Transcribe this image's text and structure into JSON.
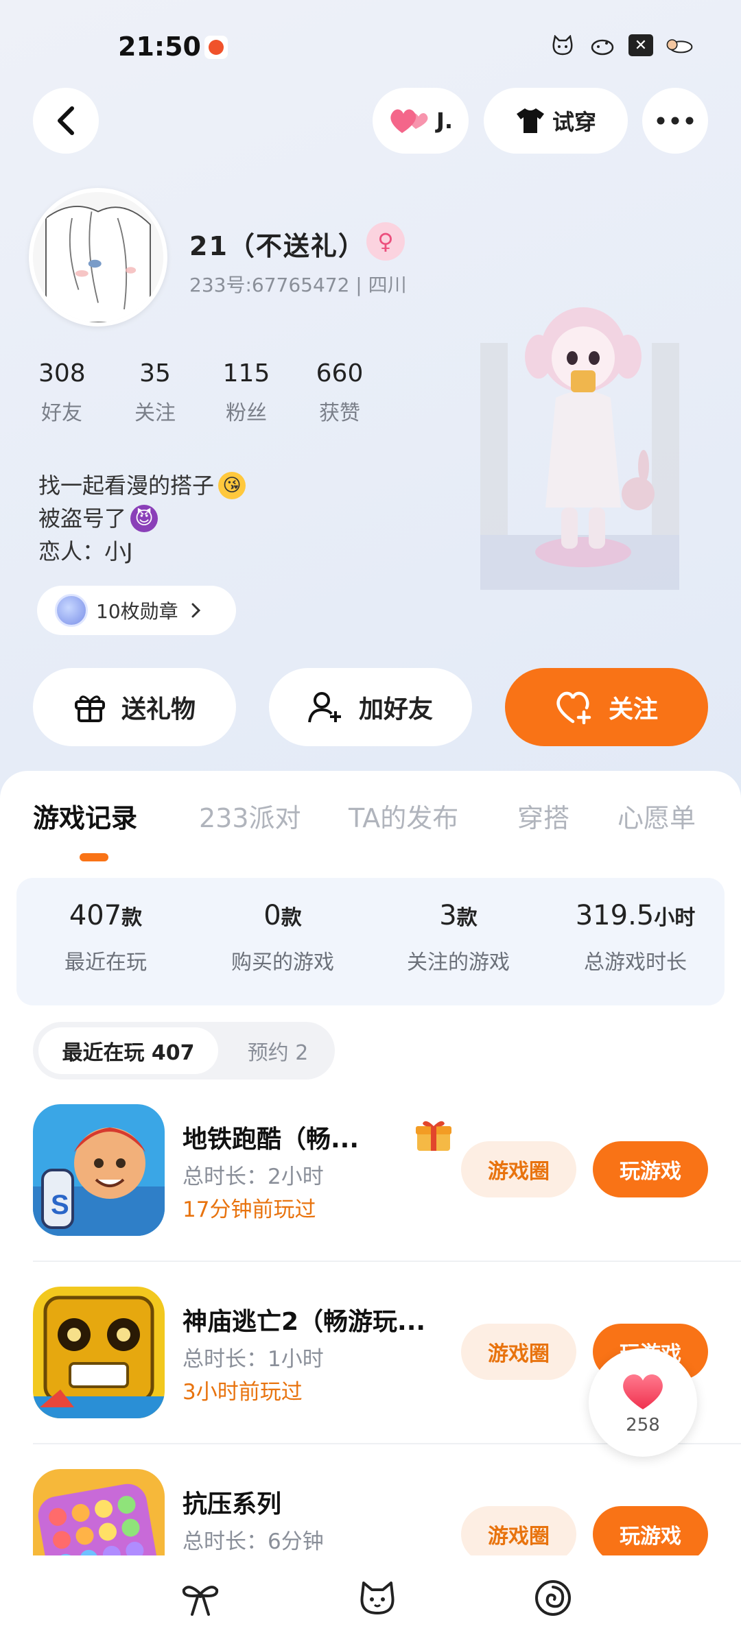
{
  "status_bar": {
    "time": "21:50"
  },
  "top_bar": {
    "cp_label": "J.",
    "try_on_label": "试穿"
  },
  "profile": {
    "nickname": "21（不送礼）",
    "id_line": "233号:67765472 | 四川",
    "stats": [
      {
        "value": "308",
        "label": "好友"
      },
      {
        "value": "35",
        "label": "关注"
      },
      {
        "value": "115",
        "label": "粉丝"
      },
      {
        "value": "660",
        "label": "获赞"
      }
    ],
    "bio_lines": [
      "找一起看漫的搭子",
      "被盗号了",
      "恋人：小J"
    ],
    "medals": "10枚勋章"
  },
  "actions": {
    "gift": "送礼物",
    "add_friend": "加好友",
    "follow": "关注"
  },
  "tabs": [
    "游戏记录",
    "233派对",
    "TA的发布",
    "穿搭",
    "心愿单"
  ],
  "game_stats": [
    {
      "value": "407",
      "unit": "款",
      "label": "最近在玩"
    },
    {
      "value": "0",
      "unit": "款",
      "label": "购买的游戏"
    },
    {
      "value": "3",
      "unit": "款",
      "label": "关注的游戏"
    },
    {
      "value": "319.5",
      "unit": "小时",
      "label": "总游戏时长"
    }
  ],
  "segments": {
    "recent": "最近在玩 407",
    "reserve": "预约 2"
  },
  "games": [
    {
      "title": "地铁跑酷（畅...",
      "duration": "总时长：2小时",
      "last_played": "17分钟前玩过"
    },
    {
      "title": "神庙逃亡2（畅游玩...",
      "duration": "总时长：1小时",
      "last_played": "3小时前玩过"
    },
    {
      "title": "抗压系列",
      "duration": "总时长：6分钟",
      "last_played": ""
    }
  ],
  "game_buttons": {
    "circle": "游戏圈",
    "play": "玩游戏"
  },
  "like_count": "258",
  "colors": {
    "accent": "#f97316",
    "accent_soft": "#fdeee3"
  }
}
